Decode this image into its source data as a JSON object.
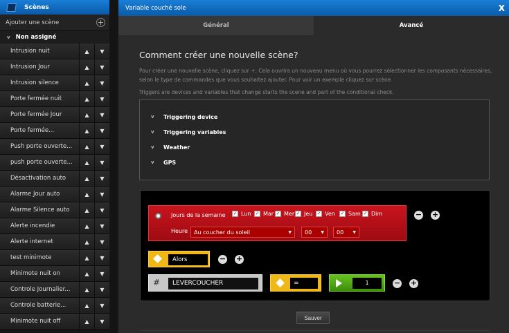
{
  "sidebar": {
    "title": "Scènes",
    "add_label": "Ajouter une scène",
    "add_icon": "+",
    "group_label": "Non assigné",
    "items": [
      {
        "label": "Intrusion nuit"
      },
      {
        "label": "Intrusion Jour"
      },
      {
        "label": "Intrusion silence"
      },
      {
        "label": "Porte fermée nuit"
      },
      {
        "label": "Porte fermée Jour"
      },
      {
        "label": "Porte fermée..."
      },
      {
        "label": "Push porte ouverte..."
      },
      {
        "label": "push porte ouverte..."
      },
      {
        "label": "Désactivation auto"
      },
      {
        "label": "Alarme Jour auto"
      },
      {
        "label": "Alarme Silence auto"
      },
      {
        "label": "Alerte incendie"
      },
      {
        "label": "Alerte internet"
      },
      {
        "label": "test minimote"
      },
      {
        "label": "Minimote nuit on"
      },
      {
        "label": "Controle Journalier..."
      },
      {
        "label": "Controle batterie..."
      },
      {
        "label": "Minimote nuit off"
      }
    ],
    "up_glyph": "▲",
    "down_glyph": "▼"
  },
  "dialog": {
    "title": "Variable couché sole",
    "close_glyph": "X",
    "tabs": [
      {
        "label": "Général",
        "active": false
      },
      {
        "label": "Avancé",
        "active": true
      }
    ],
    "heading": "Comment créer une nouvelle scène?",
    "intro": "Pour créer une nouvelle scène, cliquez sur +. Cela ouvrira un nouveau menu où vous pourrez sélectionner les composants nécessaires, selon le type de commandes que vous souhaitez ajouter. Pour voir un exemple cliquez sur scène",
    "triggers_note": "Triggers are devices and variables that change starts the scene and part of the conditional check.",
    "triggers": [
      {
        "label": "Triggering device"
      },
      {
        "label": "Triggering variables"
      },
      {
        "label": "Weather"
      },
      {
        "label": "GPS"
      }
    ],
    "chevron_glyph": "v"
  },
  "scene": {
    "days_label": "Jours de la semaine",
    "days": [
      {
        "label": "Lun",
        "checked": true
      },
      {
        "label": "Mar",
        "checked": true
      },
      {
        "label": "Mer",
        "checked": true
      },
      {
        "label": "Jeu",
        "checked": true
      },
      {
        "label": "Ven",
        "checked": true
      },
      {
        "label": "Sam",
        "checked": true
      },
      {
        "label": "Dim",
        "checked": true
      }
    ],
    "check_glyph": "✓",
    "heure_label": "Heure",
    "time_mode": "Au coucher du soleil",
    "hours": "00",
    "minutes": "00",
    "minus_glyph": "−",
    "plus_glyph": "+",
    "alors_label": "Alors",
    "variable_name": "LEVERCOUCHER",
    "hash_glyph": "#",
    "operator": "=",
    "value": "1",
    "save_label": "Sauver"
  },
  "colors": {
    "accent_blue": "#0f6fc6",
    "condition_red": "#c8141e",
    "action_yellow": "#f0b817",
    "value_green": "#4fa316"
  }
}
